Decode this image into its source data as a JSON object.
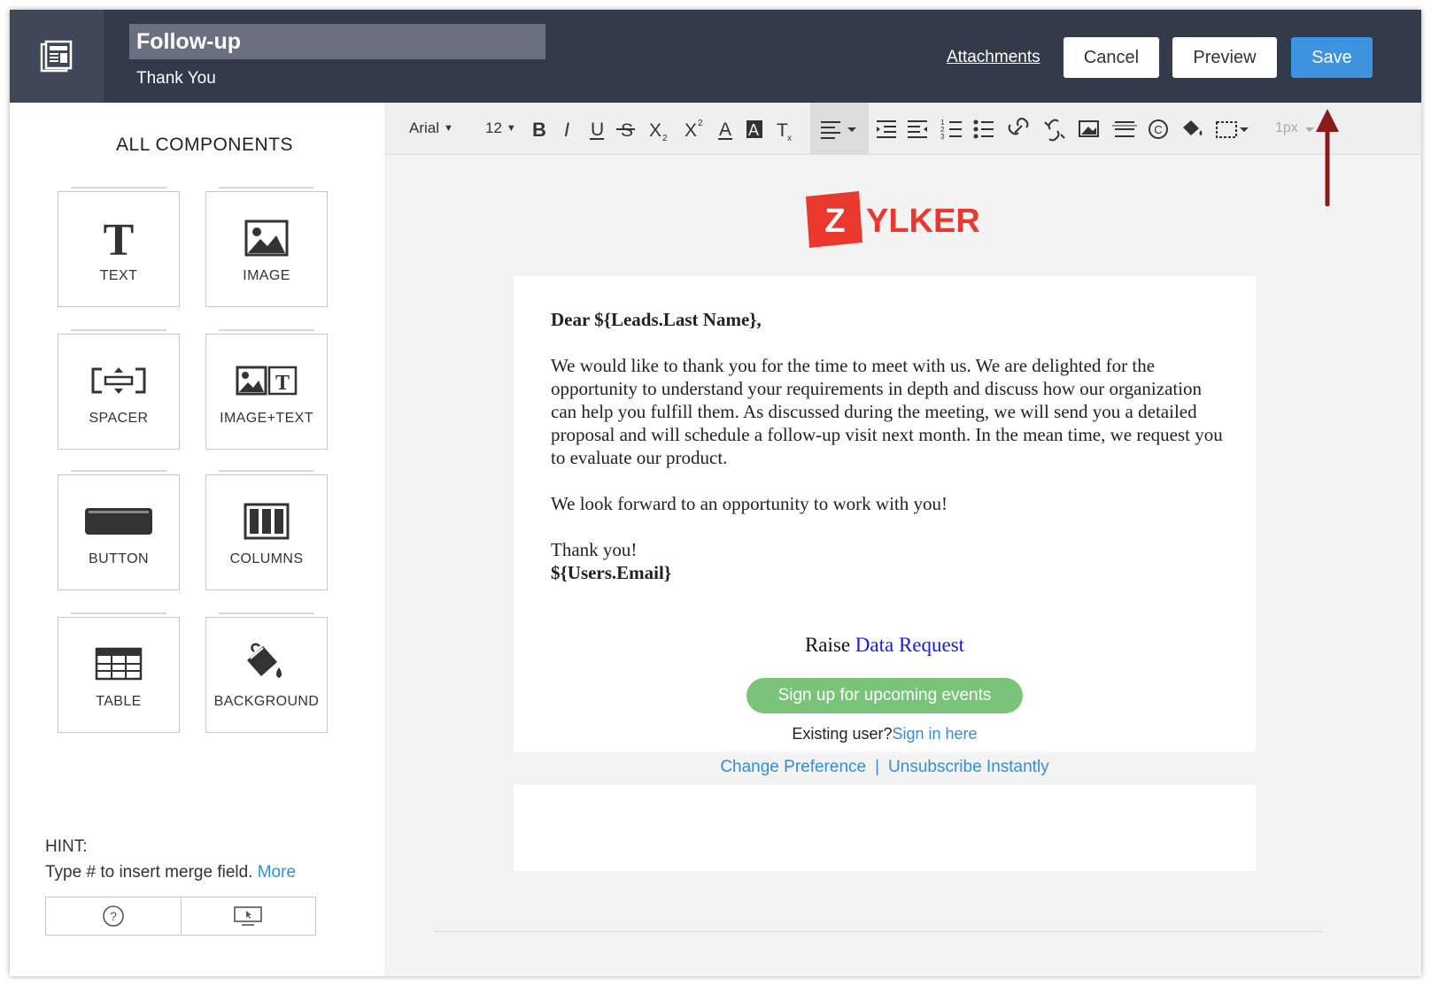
{
  "header": {
    "title": "Follow-up",
    "subtitle": "Thank You",
    "attachments_label": "Attachments",
    "cancel_label": "Cancel",
    "preview_label": "Preview",
    "save_label": "Save"
  },
  "left_panel": {
    "title": "ALL COMPONENTS",
    "components": [
      {
        "label": "TEXT",
        "icon": "text-icon"
      },
      {
        "label": "IMAGE",
        "icon": "image-icon"
      },
      {
        "label": "SPACER",
        "icon": "spacer-icon"
      },
      {
        "label": "IMAGE+TEXT",
        "icon": "image-text-icon"
      },
      {
        "label": "BUTTON",
        "icon": "button-icon"
      },
      {
        "label": "COLUMNS",
        "icon": "columns-icon"
      },
      {
        "label": "TABLE",
        "icon": "table-icon"
      },
      {
        "label": "BACKGROUND",
        "icon": "paint-bucket-icon"
      }
    ],
    "hint_label": "HINT:",
    "hint_text": "Type # to insert merge field.",
    "hint_more": "More"
  },
  "toolbar": {
    "font": "Arial",
    "size": "12",
    "border_width": "1px"
  },
  "email": {
    "logo_letter": "Z",
    "logo_text": "YLKER",
    "greeting": "Dear ${Leads.Last Name},",
    "paragraph1": "We would like to thank you for the time to meet with us. We are delighted for the opportunity to understand your requirements in depth and discuss how our organization can help you fulfill them. As discussed during the meeting, we will send you a detailed proposal and will schedule a follow-up visit next month. In the mean time, we request you to evaluate our product.",
    "paragraph2": "We look forward to an opportunity to work with you!",
    "closing": "Thank you!",
    "signature": "${Users.Email}",
    "raise_prefix": "Raise",
    "raise_link": "Data Request",
    "signup_button": "Sign up for upcoming events",
    "existing_prefix": "Existing user?",
    "existing_link": "Sign in here",
    "change_preference": "Change Preference",
    "separator": "|",
    "unsubscribe": "Unsubscribe Instantly"
  },
  "colors": {
    "header_bg": "#333b4a",
    "save_bg": "#3d93df",
    "link": "#2f8fd8",
    "signup_bg": "#79c479",
    "logo_red": "#e9392f"
  }
}
